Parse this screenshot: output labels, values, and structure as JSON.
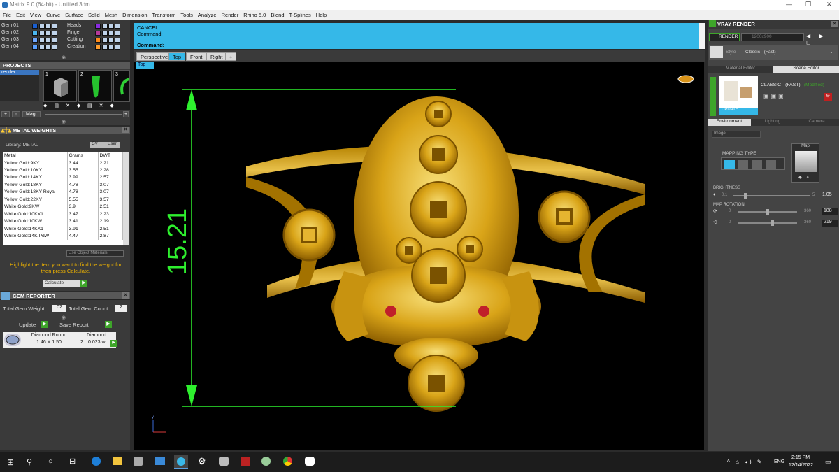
{
  "window": {
    "title": "Matrix 9.0 (64-bit) - Untitled.3dm"
  },
  "menu": [
    "File",
    "Edit",
    "View",
    "Curve",
    "Surface",
    "Solid",
    "Mesh",
    "Dimension",
    "Transform",
    "Tools",
    "Analyze",
    "Render",
    "Rhino 5.0",
    "Blend",
    "T-Splines",
    "Help"
  ],
  "layers": {
    "left": [
      {
        "label": "Gem 01",
        "color": "#1a5fd0"
      },
      {
        "label": "Gem 02",
        "color": "#4bb7f0"
      },
      {
        "label": "Gem 03",
        "color": "#6fa7ff"
      },
      {
        "label": "Gem 04",
        "color": "#5aa0ff"
      }
    ],
    "right": [
      {
        "label": "Heads",
        "color": "#8a2be2"
      },
      {
        "label": "Finger",
        "color": "#b6399a"
      },
      {
        "label": "Cutting",
        "color": "#ff8b1a"
      },
      {
        "label": "Creation",
        "color": "#ff9d2e"
      }
    ]
  },
  "projects": {
    "header": "PROJECTS",
    "item": "render",
    "thumb_numbers": [
      "1",
      "2",
      "3"
    ],
    "magic_label": "Magr"
  },
  "metal_weights": {
    "header": "METAL WEIGHTS",
    "library": "Library: METAL",
    "opt1": "GV",
    "opt2": "User",
    "columns": [
      "Metal",
      "Grams",
      "DWT"
    ],
    "rows": [
      [
        "Yellow Gold:9KY",
        "3.44",
        "2.21"
      ],
      [
        "Yellow Gold:10KY",
        "3.55",
        "2.28"
      ],
      [
        "Yellow Gold:14KY",
        "3.99",
        "2.57"
      ],
      [
        "Yellow Gold:18KY",
        "4.78",
        "3.07"
      ],
      [
        "Yellow Gold:18KY Royal",
        "4.78",
        "3.07"
      ],
      [
        "Yellow Gold:22KY",
        "5.55",
        "3.57"
      ],
      [
        "White Gold:9KW",
        "3.9",
        "2.51"
      ],
      [
        "White Gold:10KX1",
        "3.47",
        "2.23"
      ],
      [
        "White Gold:10KW",
        "3.41",
        "2.19"
      ],
      [
        "White Gold:14KX1",
        "3.91",
        "2.51"
      ],
      [
        "White Gold:14K PdW",
        "4.47",
        "2.87"
      ]
    ],
    "use_object_materials": "Use Object Materials",
    "hint": "Highlight the item you want to find the weight for then press Calculate.",
    "calculate": "Calculate"
  },
  "gem_reporter": {
    "header": "GEM REPORTER",
    "total_weight_label": "Total Gem Weight",
    "total_weight": ".02",
    "total_count_label": "Total Gem Count",
    "total_count": "2",
    "update": "Update",
    "save_report": "Save Report",
    "gem": {
      "cut": "Diamond Round",
      "type": "Diamond",
      "size": "1.46 X 1.50",
      "count": "2",
      "weight": "0.023tw"
    }
  },
  "command": {
    "line1": "CANCEL",
    "line2": "Command:",
    "prompt": "Command:"
  },
  "view_tabs": [
    "Perspective",
    "Top",
    "Front",
    "Right",
    "+"
  ],
  "viewport": {
    "label": "Top",
    "dimension": "15.21",
    "axis_y": "y"
  },
  "vray": {
    "header": "VRAY RENDER",
    "render_button": "RENDER",
    "resolution": "1200x900",
    "style_label": "Style",
    "style_value": "Classic - (Fast)",
    "tabs": [
      "Material Editor",
      "Scene Editor"
    ],
    "scene_name": "CLASSIC - (FAST)",
    "modified": "(Modified)",
    "update": "UPDATE",
    "env_tabs": [
      "Environment",
      "Lighting",
      "Camera"
    ],
    "env_type": "Image",
    "mapping_type": "MAPPING TYPE",
    "map_label": "Map",
    "brightness": {
      "label": "BRIGHTNESS",
      "min": "0.1",
      "max": "5",
      "value": "1.05"
    },
    "map_rotation": {
      "label": "MAP ROTATION",
      "row1": {
        "min": "0",
        "max": "360",
        "value": "188"
      },
      "row2": {
        "min": "0",
        "max": "360",
        "value": "219"
      }
    }
  },
  "taskbar": {
    "lang": "ENG",
    "time": "2:15 PM",
    "date": "12/14/2022"
  }
}
